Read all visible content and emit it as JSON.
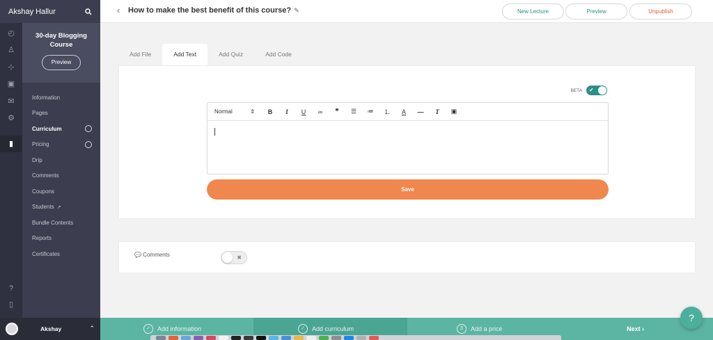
{
  "user": {
    "full_name": "Akshay Hallur",
    "short_name": "Akshay"
  },
  "course": {
    "title": "30-day Blogging Course",
    "preview_label": "Preview"
  },
  "sidebar": {
    "items": [
      {
        "label": "Information"
      },
      {
        "label": "Pages"
      },
      {
        "label": "Curriculum"
      },
      {
        "label": "Pricing"
      },
      {
        "label": "Drip"
      },
      {
        "label": "Comments"
      },
      {
        "label": "Coupons"
      },
      {
        "label": "Students"
      },
      {
        "label": "Bundle Contents"
      },
      {
        "label": "Reports"
      },
      {
        "label": "Certificates"
      }
    ]
  },
  "header": {
    "title": "How to make the best benefit of this course?",
    "new_lecture": "New Lecture",
    "preview": "Preview",
    "unpublish": "Unpublish"
  },
  "tabs": [
    "Add File",
    "Add Text",
    "Add Quiz",
    "Add Code"
  ],
  "editor": {
    "beta_label": "BETA",
    "format_select": "Normal",
    "save_label": "Save"
  },
  "comments": {
    "label": "Comments"
  },
  "steps": {
    "step1": "Add information",
    "step2": "Add curriculum",
    "step3_num": "3",
    "step3": "Add a price",
    "next": "Next ›"
  },
  "help_label": "?",
  "colors": {
    "accent": "#2c8f88",
    "save": "#f0874f",
    "unpublish": "#e15f35",
    "steps_bar": "#5bb5a2"
  }
}
